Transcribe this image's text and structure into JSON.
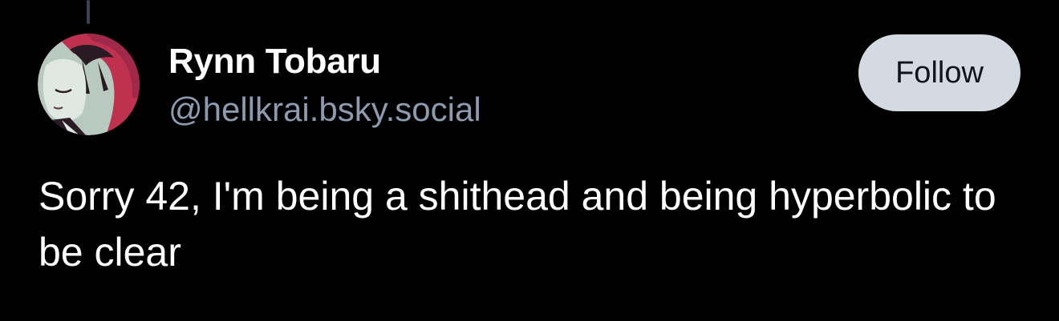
{
  "post": {
    "author": {
      "display_name": "Rynn Tobaru",
      "handle": "@hellkrai.bsky.social",
      "avatar_icon": "anime-character-avatar"
    },
    "follow_label": "Follow",
    "text": "Sorry 42, I'm being a shithead and being hyperbolic to be clear"
  },
  "colors": {
    "background": "#000000",
    "handle": "#8d9bb0",
    "follow_button_bg": "#d4d9e2",
    "thread_line": "#3a4352"
  }
}
